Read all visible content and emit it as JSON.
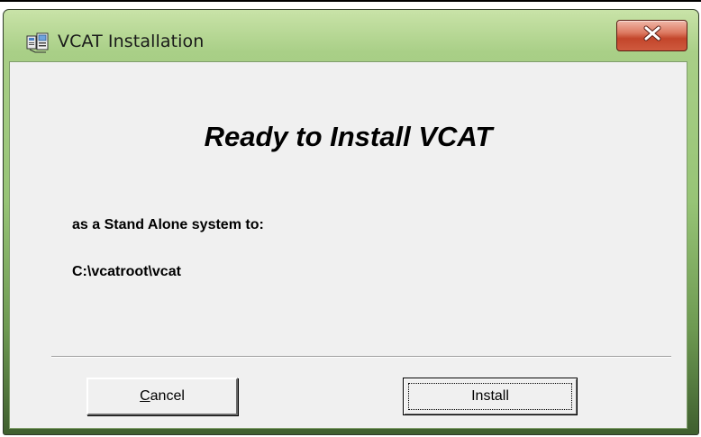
{
  "window": {
    "title": "VCAT Installation",
    "app_icon": "installer-icon",
    "close_icon": "close-icon"
  },
  "content": {
    "heading": "Ready to Install VCAT",
    "subtext": "as a Stand Alone system to:",
    "install_path": "C:\\vcatroot\\vcat"
  },
  "buttons": {
    "cancel_mnemonic": "C",
    "cancel_rest": "ancel",
    "install_label": "Install"
  },
  "colors": {
    "frame_green": "#97c476",
    "close_red": "#c3452b",
    "client_bg": "#f0f0f0"
  }
}
